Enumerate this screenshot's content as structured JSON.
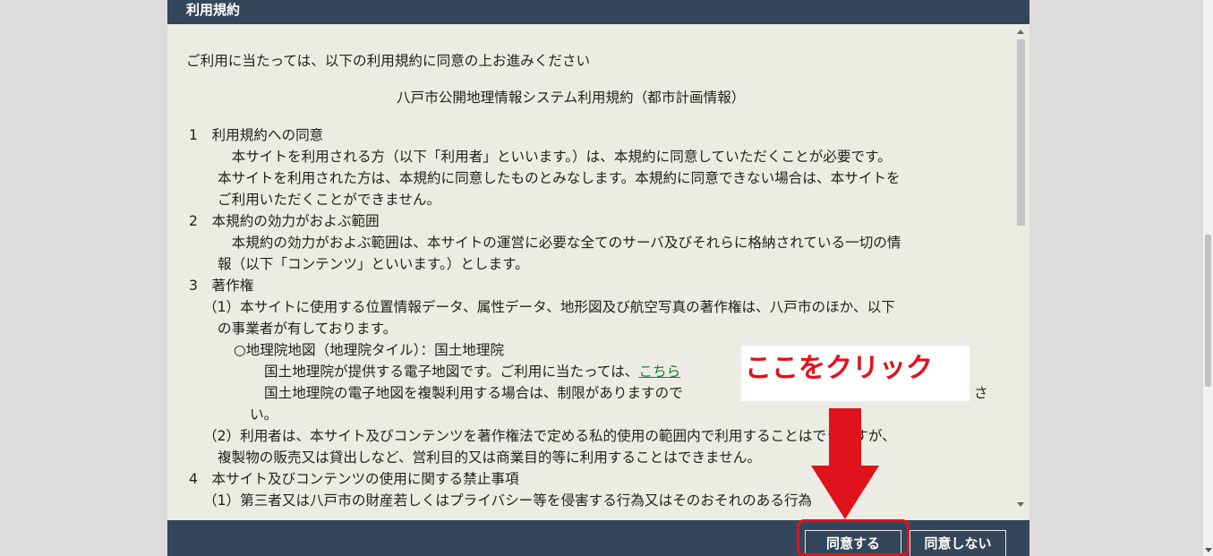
{
  "dialog": {
    "title": "利用規約",
    "intro": "ご利用に当たっては、以下の利用規約に同意の上お進みください",
    "doc_title": "八戸市公開地理情報システム利用規約（都市計画情報）",
    "lines": [
      {
        "text": "1　利用規約への同意"
      },
      {
        "text": "　本サイトを利用される方（以下「利用者」といいます。）は、本規約に同意していただくことが必要です。"
      },
      {
        "text": "本サイトを利用された方は、本規約に同意したものとみなします。本規約に同意できない場合は、本サイトを"
      },
      {
        "text": "ご利用いただくことができません。"
      },
      {
        "text": "2　本規約の効力がおよぶ範囲"
      },
      {
        "text": "　本規約の効力がおよぶ範囲は、本サイトの運営に必要な全てのサーバ及びそれらに格納されている一切の情"
      },
      {
        "text": "報（以下「コンテンツ」といいます。）とします。"
      },
      {
        "text": "3　著作権"
      },
      {
        "text": "（1）本サイトに使用する位置情報データ、属性データ、地形図及び航空写真の著作権は、八戸市のほか、以下"
      },
      {
        "text": "の事業者が有しております。"
      },
      {
        "text": "○地理院地図（地理院タイル）：国土地理院"
      },
      {
        "text": "国土地理院が提供する電子地図です。ご利用に当たっては、",
        "link": "こちら"
      },
      {
        "text": "国土地理院の電子地図を複製利用する場合は、制限がありますので",
        "tail": "さ"
      },
      {
        "text": "い。"
      },
      {
        "text": "（2）利用者は、本サイト及びコンテンツを著作権法で定める私的使用の範囲内で利用することはできますが、"
      },
      {
        "text": "複製物の販売又は貸出しなど、営利目的又は商業目的等に利用することはできません。"
      },
      {
        "text": "4　本サイト及びコンテンツの使用に関する禁止事項"
      },
      {
        "text": "（1）第三者又は八戸市の財産若しくはプライバシー等を侵害する行為又はそのおそれのある行為"
      }
    ],
    "buttons": {
      "agree": "同意する",
      "disagree": "同意しない"
    }
  },
  "annotation": {
    "callout": "ここをクリック",
    "color": "#e0121b"
  },
  "colors": {
    "header": "#34465a",
    "body": "#ecece4",
    "link": "#1a7f2e"
  }
}
